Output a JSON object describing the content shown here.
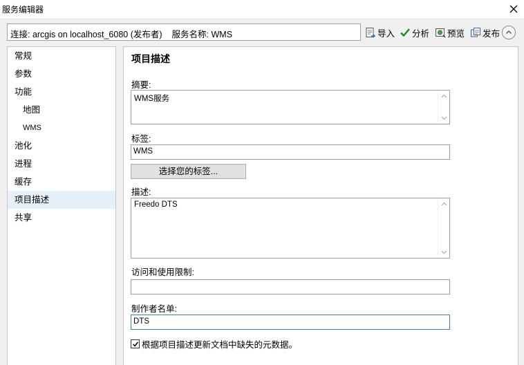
{
  "window": {
    "title": "服务编辑器"
  },
  "toolbar": {
    "connection": "连接: arcgis on localhost_6080 (发布者)",
    "service_name": "服务名称: WMS",
    "buttons": {
      "import": "导入",
      "analyze": "分析",
      "preview": "预览",
      "publish": "发布"
    }
  },
  "sidebar": {
    "items": [
      {
        "label": "常规"
      },
      {
        "label": "参数"
      },
      {
        "label": "功能"
      },
      {
        "label": "地图"
      },
      {
        "label": "WMS"
      },
      {
        "label": "池化"
      },
      {
        "label": "进程"
      },
      {
        "label": "缓存"
      },
      {
        "label": "项目描述"
      },
      {
        "label": "共享"
      }
    ],
    "selected": "项目描述"
  },
  "main": {
    "heading": "项目描述",
    "summary": {
      "label": "摘要:",
      "value": "WMS服务"
    },
    "tags": {
      "label": "标签:",
      "value": "WMS",
      "button": "选择您的标签..."
    },
    "description": {
      "label": "描述:",
      "value": "Freedo DTS"
    },
    "access": {
      "label": "访问和使用限制:",
      "value": ""
    },
    "credits": {
      "label": "制作者名单:",
      "value": "DTS"
    },
    "update_checkbox": {
      "label": "根据项目描述更新文档中缺失的元数据。",
      "checked": true
    }
  },
  "colors": {
    "selection": "#e5f0fb",
    "check_green": "#1a8a1a",
    "focus_border": "#3c7fb1"
  },
  "icons": [
    "close-icon",
    "import-icon",
    "analyze-icon",
    "preview-icon",
    "publish-icon",
    "collapse-icon",
    "scroll-up-icon",
    "scroll-down-icon",
    "checkmark-icon"
  ]
}
